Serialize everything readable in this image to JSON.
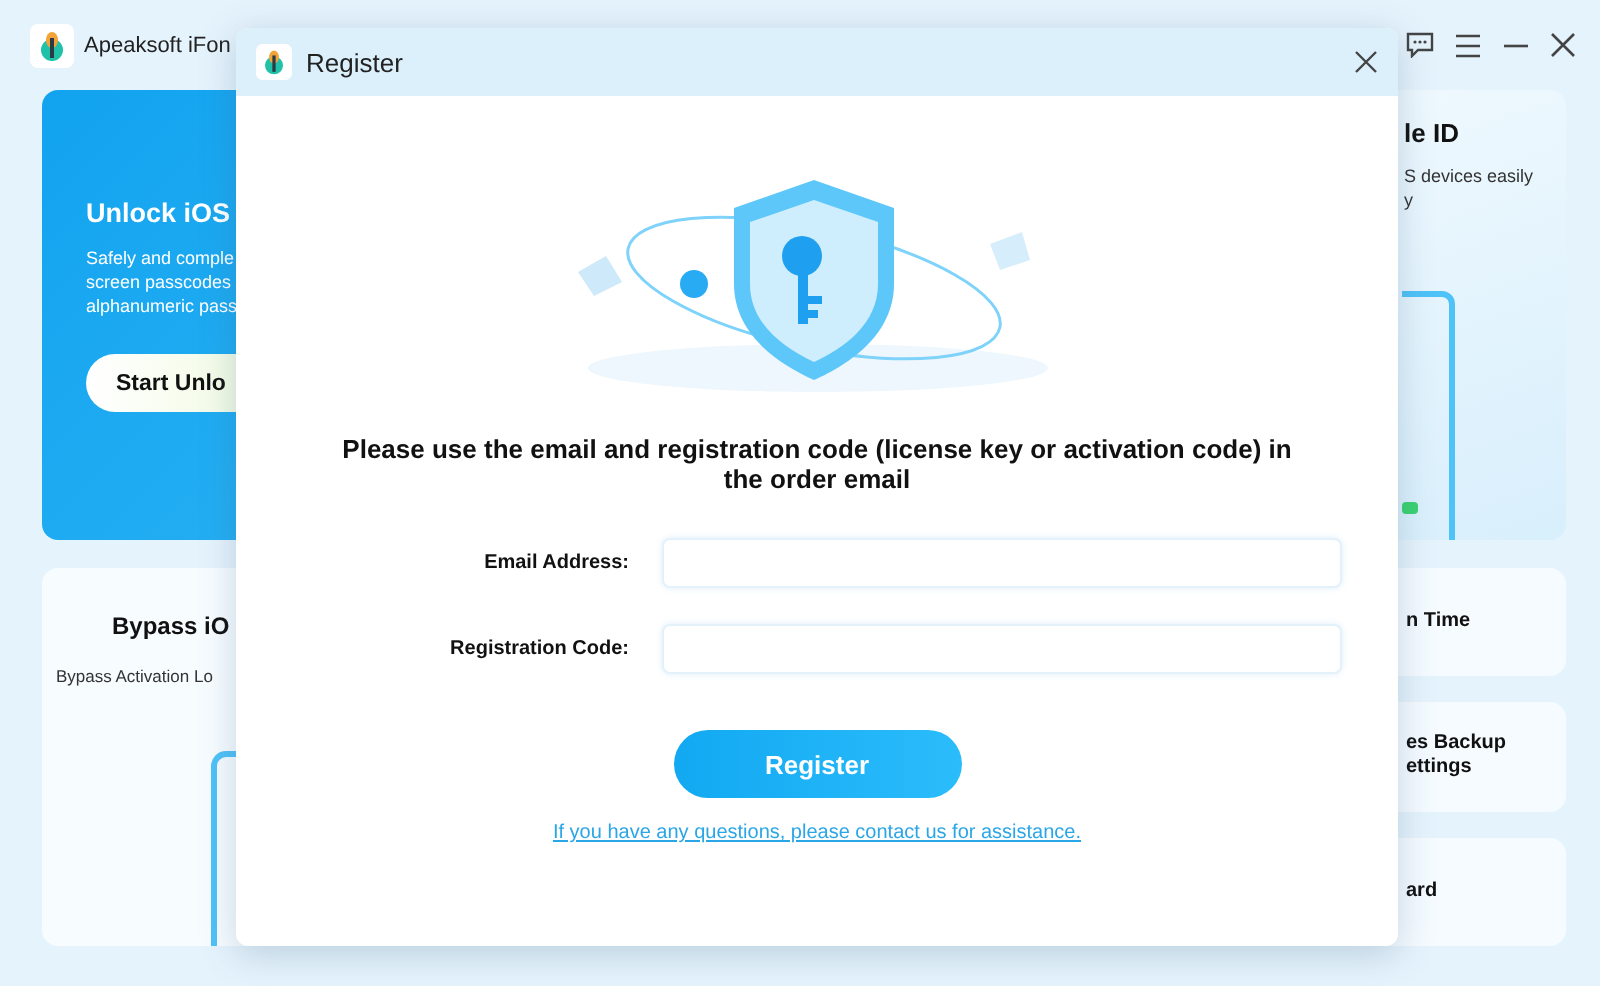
{
  "app": {
    "title": "Apeaksoft iFon"
  },
  "main_cards": [
    {
      "kind": "hero",
      "title": "Unlock iOS",
      "description": [
        "Safely and comple",
        "screen passcodes",
        "alphanumeric pass"
      ],
      "button": "Start Unlo"
    },
    {
      "kind": "plain",
      "title": "Bypass iO",
      "description": [
        "Bypass Activation Lo"
      ]
    }
  ],
  "top_side_card": {
    "title": "le ID",
    "description": [
      "S devices easily",
      "y"
    ]
  },
  "side_cards": [
    {
      "title_lines": [
        "n Time"
      ]
    },
    {
      "title_lines": [
        "es Backup",
        "ettings"
      ]
    },
    {
      "title_lines": [
        "ard"
      ]
    }
  ],
  "dialog": {
    "title": "Register",
    "message": "Please use the email and registration code (license key or activation code) in the order email",
    "fields": [
      {
        "label": "Email Address:"
      },
      {
        "label": "Registration Code:"
      }
    ],
    "button": "Register",
    "help_link": "If you have any questions, please contact us for assistance."
  }
}
